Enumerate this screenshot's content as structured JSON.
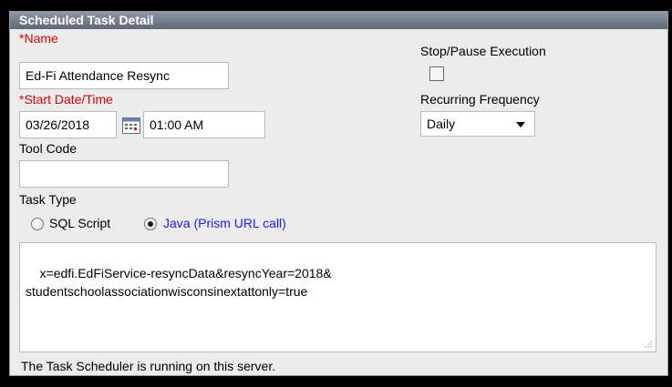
{
  "panel": {
    "title": "Scheduled Task Detail",
    "status": "The Task Scheduler is running on this server."
  },
  "name": {
    "required_mark": "*",
    "label": "Name",
    "value": "Ed-Fi Attendance Resync"
  },
  "start": {
    "required_mark": "*",
    "label": "Start Date/Time",
    "date": "03/26/2018",
    "time": "01:00 AM"
  },
  "tool_code": {
    "label": "Tool Code",
    "value": ""
  },
  "stop_pause": {
    "label": "Stop/Pause Execution",
    "checked": false
  },
  "recurring": {
    "label": "Recurring Frequency",
    "value": "Daily"
  },
  "task_type": {
    "label": "Task Type",
    "options": [
      {
        "label": "SQL Script",
        "selected": false
      },
      {
        "label": "Java (Prism URL call)",
        "selected": true
      }
    ]
  },
  "script_text": "x=edfi.EdFiService-resyncData&resyncYear=2018&\nstudentschoolassociationwisconsinextattonly=true",
  "colors": {
    "title_bar": "#5d6776",
    "required": "#e00000",
    "selected_option": "#1a1aff"
  }
}
